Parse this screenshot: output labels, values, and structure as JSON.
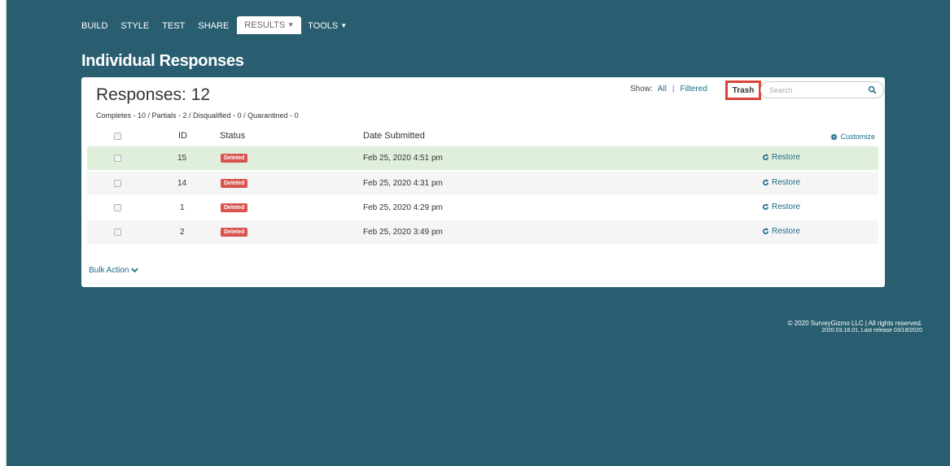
{
  "nav": {
    "build": "BUILD",
    "style": "STYLE",
    "test": "TEST",
    "share": "SHARE",
    "results": "RESULTS",
    "tools": "TOOLS"
  },
  "page_title": "Individual Responses",
  "panel": {
    "responses_count": "Responses: 12",
    "summary": "Completes - 10 / Partials - 2 / Disqualified - 0 / Quarantined - 0",
    "show_label": "Show:",
    "show_all": "All",
    "show_filtered": "Filtered",
    "trash": "Trash",
    "search_placeholder": "Search",
    "customize": "Customize",
    "bulk_action": "Bulk Action"
  },
  "table": {
    "headers": {
      "id": "ID",
      "status": "Status",
      "date": "Date Submitted"
    },
    "rows": [
      {
        "id": "15",
        "status": "Deleted",
        "date": "Feb 25, 2020 4:51 pm",
        "action": "Restore"
      },
      {
        "id": "14",
        "status": "Deleted",
        "date": "Feb 25, 2020 4:31 pm",
        "action": "Restore"
      },
      {
        "id": "1",
        "status": "Deleted",
        "date": "Feb 25, 2020 4:29 pm",
        "action": "Restore"
      },
      {
        "id": "2",
        "status": "Deleted",
        "date": "Feb 25, 2020 3:49 pm",
        "action": "Restore"
      }
    ]
  },
  "footer": {
    "copyright": "© 2020 SurveyGizmo LLC | All rights reserved.",
    "release": "2020.03.18.01, Last release 03/18/2020"
  },
  "colors": {
    "app_background": "#285e70",
    "row_highlight": "#e0efdc",
    "row_alt": "#f5f5f5",
    "deleted_badge": "#d9534f",
    "trash_highlight_border": "#d9443a",
    "link": "#1c6a86"
  },
  "icons": [
    "search-icon",
    "gear-icon",
    "refresh-icon",
    "chevron-down-icon",
    "caret-down-icon"
  ]
}
